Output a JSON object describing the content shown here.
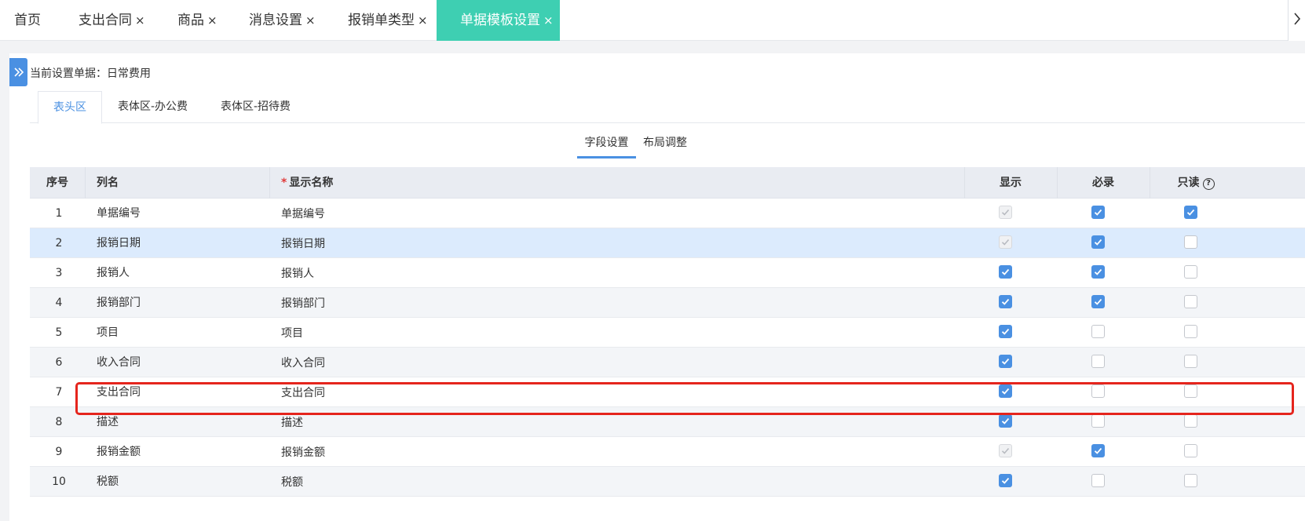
{
  "tabs": [
    {
      "label": "首页",
      "closable": false,
      "active": false
    },
    {
      "label": "支出合同",
      "closable": true,
      "active": false
    },
    {
      "label": "商品",
      "closable": true,
      "active": false
    },
    {
      "label": "消息设置",
      "closable": true,
      "active": false
    },
    {
      "label": "报销单类型",
      "closable": true,
      "active": false
    },
    {
      "label": "单据模板设置",
      "closable": true,
      "active": true
    }
  ],
  "close_glyph": "×",
  "current_doc_label": "当前设置单据：日常费用",
  "sub_tabs": [
    {
      "label": "表头区",
      "active": true
    },
    {
      "label": "表体区-办公费",
      "active": false
    },
    {
      "label": "表体区-招待费",
      "active": false
    }
  ],
  "modes": [
    {
      "label": "字段设置",
      "active": true
    },
    {
      "label": "布局调整",
      "active": false
    }
  ],
  "columns": {
    "index": "序号",
    "field": "列名",
    "display_name": "显示名称",
    "show": "显示",
    "required": "必录",
    "readonly": "只读"
  },
  "required_marker": "*",
  "help_glyph": "?",
  "rows": [
    {
      "index": "1",
      "field": "单据编号",
      "display_name": "单据编号",
      "show": "disabled-checked",
      "required": "checked",
      "readonly": "checked"
    },
    {
      "index": "2",
      "field": "报销日期",
      "display_name": "报销日期",
      "show": "disabled-checked",
      "required": "checked",
      "readonly": "unchecked",
      "selected": true
    },
    {
      "index": "3",
      "field": "报销人",
      "display_name": "报销人",
      "show": "checked",
      "required": "checked",
      "readonly": "unchecked"
    },
    {
      "index": "4",
      "field": "报销部门",
      "display_name": "报销部门",
      "show": "checked",
      "required": "checked",
      "readonly": "unchecked"
    },
    {
      "index": "5",
      "field": "项目",
      "display_name": "项目",
      "show": "checked",
      "required": "unchecked",
      "readonly": "unchecked"
    },
    {
      "index": "6",
      "field": "收入合同",
      "display_name": "收入合同",
      "show": "checked",
      "required": "unchecked",
      "readonly": "unchecked"
    },
    {
      "index": "7",
      "field": "支出合同",
      "display_name": "支出合同",
      "show": "checked",
      "required": "unchecked",
      "readonly": "unchecked",
      "highlighted": true
    },
    {
      "index": "8",
      "field": "描述",
      "display_name": "描述",
      "show": "checked",
      "required": "unchecked",
      "readonly": "unchecked"
    },
    {
      "index": "9",
      "field": "报销金额",
      "display_name": "报销金额",
      "show": "disabled-checked",
      "required": "checked",
      "readonly": "unchecked"
    },
    {
      "index": "10",
      "field": "税额",
      "display_name": "税额",
      "show": "checked",
      "required": "unchecked",
      "readonly": "unchecked"
    }
  ],
  "colors": {
    "active_tab": "#3ecfb2",
    "accent_blue": "#4a90e2",
    "selected_row": "#dcebfd",
    "highlight_border": "#e5251d"
  },
  "icons": {
    "expand": "double-chevron-right-icon",
    "overflow": "chevron-right-icon",
    "help": "question-circle-icon"
  }
}
